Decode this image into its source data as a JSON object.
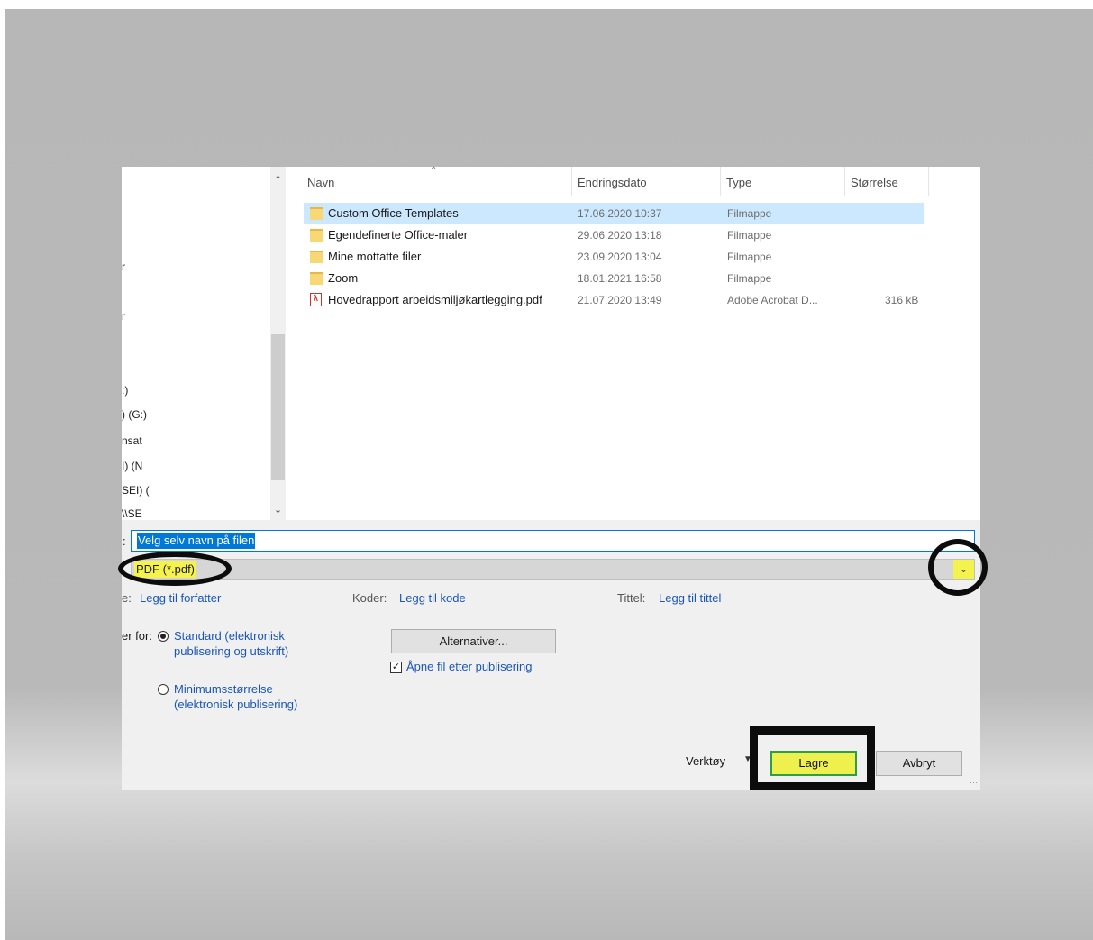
{
  "file_list": {
    "headers": {
      "name": "Navn",
      "date": "Endringsdato",
      "type": "Type",
      "size": "Størrelse"
    },
    "rows": [
      {
        "name": "Custom Office Templates",
        "date": "17.06.2020 10:37",
        "type": "Filmappe",
        "size": "",
        "icon": "folder-icon",
        "selected": true
      },
      {
        "name": "Egendefinerte Office-maler",
        "date": "29.06.2020 13:18",
        "type": "Filmappe",
        "size": "",
        "icon": "folder-icon"
      },
      {
        "name": "Mine mottatte filer",
        "date": "23.09.2020 13:04",
        "type": "Filmappe",
        "size": "",
        "icon": "folder-icon"
      },
      {
        "name": "Zoom",
        "date": "18.01.2021 16:58",
        "type": "Filmappe",
        "size": "",
        "icon": "folder-icon"
      },
      {
        "name": "Hovedrapport arbeidsmiljøkartlegging.pdf",
        "date": "21.07.2020 13:49",
        "type": "Adobe Acrobat D...",
        "size": "316 kB",
        "icon": "pdf-icon"
      }
    ]
  },
  "nav_pane": {
    "fragments": [
      "r",
      "r",
      ":)",
      ") (G:)",
      "nsat",
      "I) (N",
      "SEI) (",
      "\\\\SE"
    ]
  },
  "filename": {
    "label": ":",
    "value": "Velg selv navn på filen"
  },
  "filetype": {
    "value": "PDF (*.pdf)"
  },
  "metadata": {
    "author_label": "e:",
    "author_link": "Legg til forfatter",
    "tags_label": "Koder:",
    "tags_link": "Legg til kode",
    "title_label": "Tittel:",
    "title_link": "Legg til tittel"
  },
  "optimize": {
    "label": "er for:",
    "standard": "Standard (elektronisk publisering og utskrift)",
    "minimum": "Minimumsstørrelse (elektronisk publisering)",
    "selected": "standard"
  },
  "options_button": "Alternativer...",
  "open_after": {
    "label": "Åpne fil etter publisering",
    "checked": true
  },
  "footer": {
    "tools": "Verktøy",
    "save": "Lagre",
    "cancel": "Avbryt"
  },
  "colors": {
    "highlight": "#f4f24d",
    "annotation": "#0c0c0c",
    "link": "#1a56b8",
    "selection": "#0078d7"
  }
}
